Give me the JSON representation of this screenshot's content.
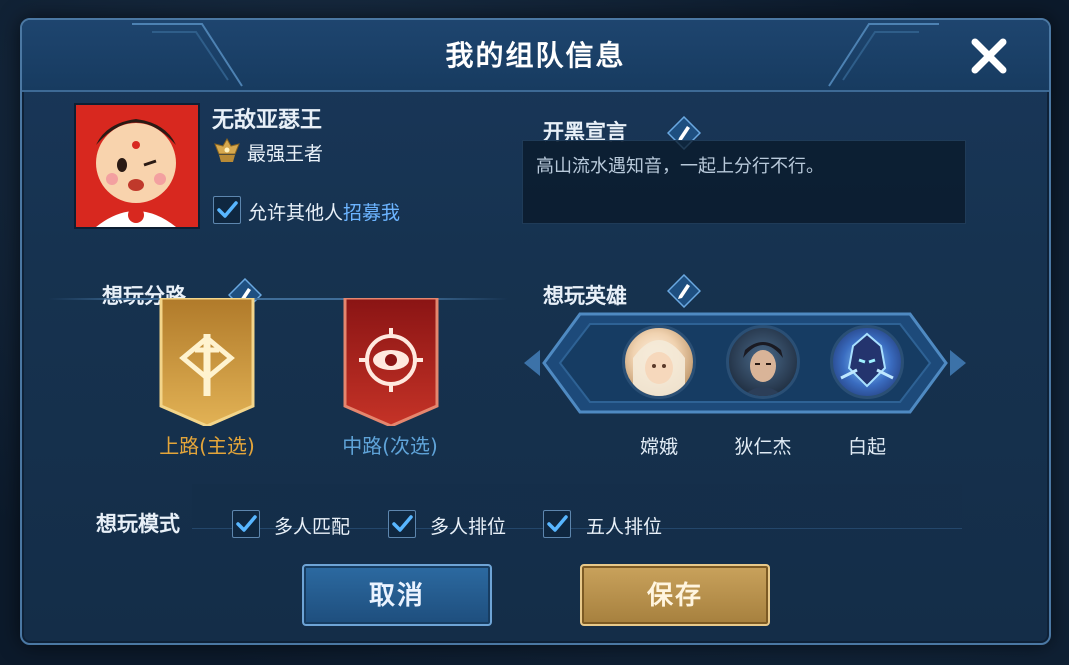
{
  "dialog": {
    "title": "我的组队信息"
  },
  "profile": {
    "name": "无敌亚瑟王",
    "rank": "最强王者",
    "recruit_text": "允许其他人",
    "recruit_link": "招募我",
    "recruit_checked": true
  },
  "declaration": {
    "label": "开黑宣言",
    "text": "高山流水遇知音，一起上分行不行。"
  },
  "lanes": {
    "label": "想玩分路",
    "primary": {
      "label": "上路(主选)",
      "color": "#e3a53a"
    },
    "secondary": {
      "label": "中路(次选)",
      "color": "#5fa3d8"
    }
  },
  "heroes": {
    "label": "想玩英雄",
    "items": [
      {
        "name": "嫦娥"
      },
      {
        "name": "狄仁杰"
      },
      {
        "name": "白起"
      }
    ]
  },
  "modes": {
    "label": "想玩模式",
    "items": [
      {
        "label": "多人匹配",
        "checked": true
      },
      {
        "label": "多人排位",
        "checked": true
      },
      {
        "label": "五人排位",
        "checked": true
      }
    ]
  },
  "buttons": {
    "cancel": "取消",
    "save": "保存"
  },
  "colors": {
    "accent_blue": "#6cb4ff",
    "panel": "#16324f",
    "gold": "#c9a25c"
  }
}
